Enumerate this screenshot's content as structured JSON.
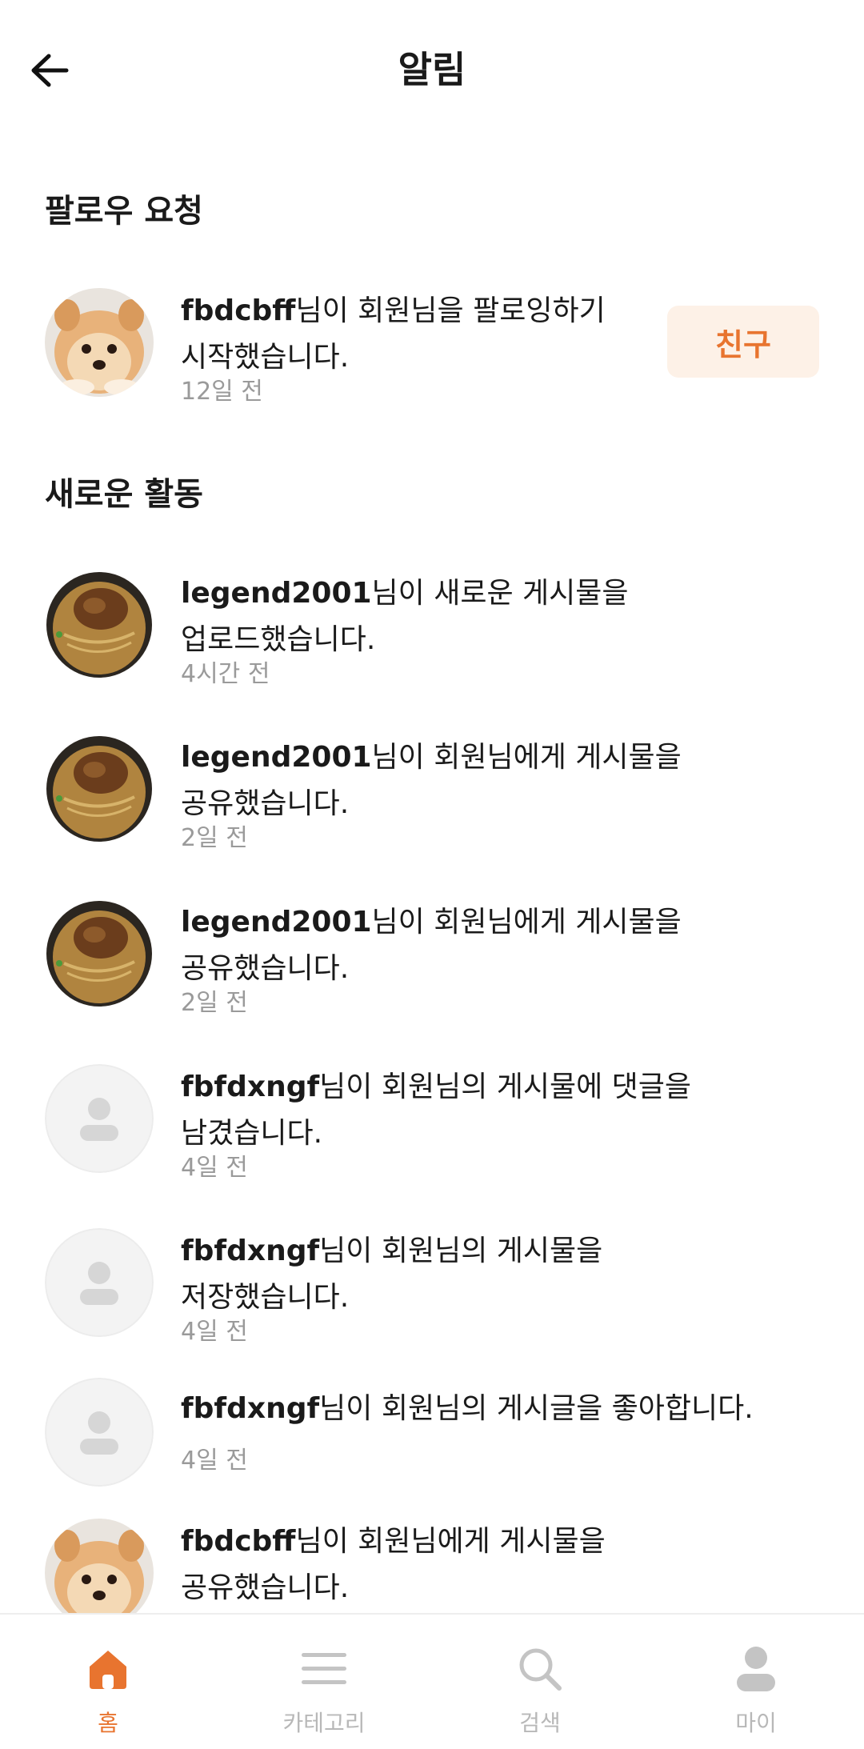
{
  "header": {
    "title": "알림",
    "back_icon": "arrow-left-icon"
  },
  "follow_requests": {
    "title": "팔로우 요청",
    "items": [
      {
        "user": "fbdcbff",
        "line1_rest": "님이 회원님을 팔로잉하기",
        "line2": "시작했습니다.",
        "time": "12일 전",
        "avatar": "dog",
        "action_label": "친구"
      }
    ]
  },
  "activity": {
    "title": "새로운 활동",
    "items": [
      {
        "user": "legend2001",
        "line1_rest": "님이 새로운 게시물을",
        "line2": "업로드했습니다.",
        "time": "4시간 전",
        "avatar": "food"
      },
      {
        "user": "legend2001",
        "line1_rest": "님이 회원님에게 게시물을",
        "line2": "공유했습니다.",
        "time": "2일 전",
        "avatar": "food"
      },
      {
        "user": "legend2001",
        "line1_rest": "님이 회원님에게 게시물을",
        "line2": "공유했습니다.",
        "time": "2일 전",
        "avatar": "food"
      },
      {
        "user": "fbfdxngf",
        "line1_rest": "님이 회원님의 게시물에 댓글을",
        "line2": "남겼습니다.",
        "time": "4일 전",
        "avatar": "default"
      },
      {
        "user": "fbfdxngf",
        "line1_rest": "님이 회원님의 게시물을",
        "line2": "저장했습니다.",
        "time": "4일 전",
        "avatar": "default"
      },
      {
        "user": "fbfdxngf",
        "line1_rest": "님이 회원님의 게시글을 좋아합니다.",
        "line2": "",
        "time": "4일 전",
        "avatar": "default"
      },
      {
        "user": "fbdcbff",
        "line1_rest": "님이 회원님에게 게시물을",
        "line2": "공유했습니다.",
        "time": "",
        "avatar": "dog"
      }
    ]
  },
  "bottom_nav": {
    "items": [
      {
        "label": "홈",
        "icon": "home-icon",
        "active": true
      },
      {
        "label": "카테고리",
        "icon": "menu-icon",
        "active": false
      },
      {
        "label": "검색",
        "icon": "search-icon",
        "active": false
      },
      {
        "label": "마이",
        "icon": "user-icon",
        "active": false
      }
    ]
  },
  "colors": {
    "accent": "#e8742f",
    "accent_bg": "#fdf1e7",
    "muted_text": "#9a9a9a",
    "inactive_nav": "#b8b8b8"
  }
}
